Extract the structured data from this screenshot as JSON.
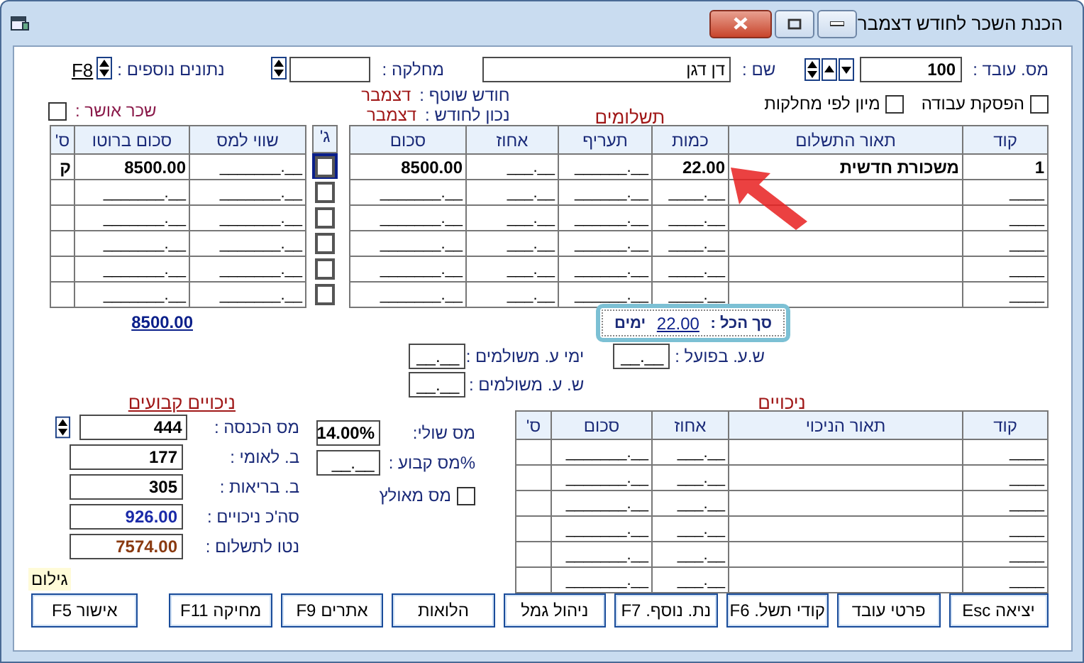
{
  "window": {
    "title": "הכנת השכר לחודש דצמבר"
  },
  "employee": {
    "number_label": "מס. עובד :",
    "number": "100",
    "name_label": "שם :",
    "name": "דן דגן",
    "department_label": "מחלקה :",
    "extra_label": "נתונים נוספים :",
    "extra_key": "F8"
  },
  "options": [
    {
      "label": "הפסקת עבודה",
      "checked": false
    },
    {
      "label": "מיון לפי מחלקות",
      "checked": false
    }
  ],
  "period": [
    {
      "label": "חודש שוטף :",
      "value": "דצמבר"
    },
    {
      "label": "נכון לחודש :",
      "value": "דצמבר"
    }
  ],
  "approved": {
    "label": "שכר אושר :",
    "checked": false
  },
  "payments": {
    "title": "תשלומים",
    "columns": [
      "קוד",
      "תאור התשלום",
      "כמות",
      "תעריף",
      "אחוז",
      "סכום"
    ],
    "rows": [
      [
        "1",
        "משכורת חדשית",
        "22.00",
        "______.__",
        "___.__",
        "8500.00"
      ],
      [
        "____",
        "",
        "____.__",
        "______.__",
        "___.__",
        "_______.__"
      ],
      [
        "____",
        "",
        "____.__",
        "______.__",
        "___.__",
        "_______.__"
      ],
      [
        "____",
        "",
        "____.__",
        "______.__",
        "___.__",
        "_______.__"
      ],
      [
        "____",
        "",
        "____.__",
        "______.__",
        "___.__",
        "_______.__"
      ],
      [
        "____",
        "",
        "____.__",
        "______.__",
        "___.__",
        "_______.__"
      ]
    ]
  },
  "gross": {
    "check_column": "ג'",
    "columns": [
      "שווי למס",
      "סכום ברוטו",
      "ס'"
    ],
    "rows": [
      {
        "checked": false,
        "focused": true,
        "cells": [
          "_______.__",
          "8500.00",
          "ק"
        ]
      },
      {
        "checked": false,
        "focused": false,
        "cells": [
          "_______.__",
          "_______.__",
          ""
        ]
      },
      {
        "checked": false,
        "focused": false,
        "cells": [
          "_______.__",
          "_______.__",
          ""
        ]
      },
      {
        "checked": false,
        "focused": false,
        "cells": [
          "_______.__",
          "_______.__",
          ""
        ]
      },
      {
        "checked": false,
        "focused": false,
        "cells": [
          "_______.__",
          "_______.__",
          ""
        ]
      },
      {
        "checked": false,
        "focused": false,
        "cells": [
          "_______.__",
          "_______.__",
          ""
        ]
      }
    ],
    "total": "8500.00"
  },
  "summary_tip": {
    "label": "סך הכל :",
    "value": "22.00",
    "unit": "ימים"
  },
  "hours": [
    {
      "label": "ש.ע. בפועל :",
      "value": "__.__"
    },
    {
      "label": "ימי ע. משולמים :",
      "value": "__.__"
    },
    {
      "label": "ש. ע. משולמים :",
      "value": "__.__"
    }
  ],
  "deductions": {
    "title": "ניכויים",
    "columns": [
      "קוד",
      "תאור הניכוי",
      "אחוז",
      "סכום",
      "ס'"
    ],
    "rows": [
      [
        "____",
        "",
        "___.__",
        "_______.__",
        ""
      ],
      [
        "____",
        "",
        "___.__",
        "_______.__",
        ""
      ],
      [
        "____",
        "",
        "___.__",
        "_______.__",
        ""
      ],
      [
        "____",
        "",
        "___.__",
        "_______.__",
        ""
      ],
      [
        "____",
        "",
        "___.__",
        "_______.__",
        ""
      ],
      [
        "____",
        "",
        "___.__",
        "_______.__",
        ""
      ]
    ]
  },
  "tax": {
    "marginal_label": "מס שולי:",
    "marginal": "14.00%",
    "fixed_label": "%מס קבוע :",
    "fixed": "__.__",
    "forced": {
      "label": "מס מאולץ",
      "checked": false
    }
  },
  "fixed_deductions": {
    "title": "ניכויים קבועים",
    "items": [
      {
        "label": "מס הכנסה :",
        "value": "444",
        "kind": "plain"
      },
      {
        "label": "ב. לאומי :",
        "value": "177",
        "kind": "plain"
      },
      {
        "label": "ב. בריאות :",
        "value": "305",
        "kind": "plain"
      },
      {
        "label": "סה'כ ניכויים :",
        "value": "926.00",
        "kind": "total"
      },
      {
        "label": "נטו לתשלום :",
        "value": "7574.00",
        "kind": "net"
      }
    ]
  },
  "gross_up": "גילום",
  "buttons": [
    "יציאה Esc",
    "פרטי עובד",
    "קודי תשל. F6",
    "נת. נוסף. F7",
    "ניהול גמל",
    "הלואות",
    "אתרים F9",
    "מחיקה F11",
    "אישור F5"
  ]
}
